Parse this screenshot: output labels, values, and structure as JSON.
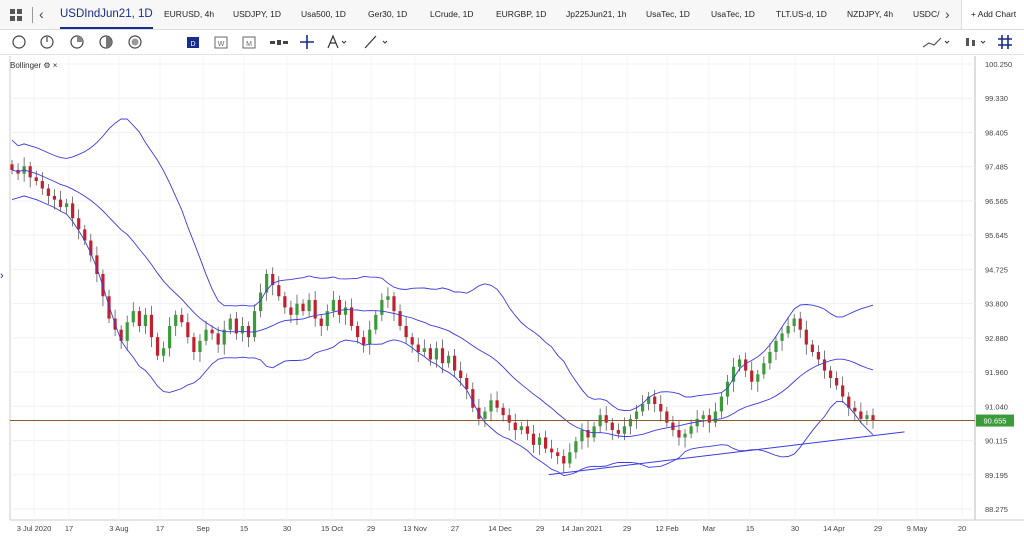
{
  "tabs": [
    {
      "label": "USDIndJun21, 1D",
      "active": true
    },
    {
      "label": "EURUSD, 4h"
    },
    {
      "label": "USDJPY, 1D"
    },
    {
      "label": "Usa500, 1D"
    },
    {
      "label": "Ger30, 1D"
    },
    {
      "label": "LCrude, 1D"
    },
    {
      "label": "EURGBP, 1D"
    },
    {
      "label": "Jp225Jun21, 1h"
    },
    {
      "label": "UsaTec, 1D"
    },
    {
      "label": "UsaTec, 1D"
    },
    {
      "label": "TLT.US-d, 1D"
    },
    {
      "label": "NZDJPY, 4h"
    },
    {
      "label": "USDC/"
    }
  ],
  "add_chart_label": "+ Add Chart",
  "toolbar_icons": [
    "circle-icon",
    "clock-icon",
    "pie-icon",
    "half-circle-icon",
    "target-icon",
    "calendar-d-icon",
    "calendar-w-icon",
    "calendar-m-icon",
    "bars-icon",
    "crosshair-icon",
    "text-a-icon",
    "line-tool-icon",
    "chart-style-icon",
    "candles-icon",
    "grid-icon"
  ],
  "indicator": {
    "label": "Bollinger",
    "settings_icon": "gear-icon",
    "close_icon": "close-icon"
  },
  "chart_data": {
    "type": "candlestick",
    "symbol": "USDIndJun21, 1D",
    "y_ticks": [
      100.25,
      99.33,
      98.405,
      97.485,
      96.565,
      95.645,
      94.725,
      93.8,
      92.88,
      91.96,
      91.04,
      90.115,
      89.195,
      88.275
    ],
    "y_tick_labels": [
      "100.250",
      "99.330",
      "98.405",
      "97.485",
      "96.565",
      "95.645",
      "94.725",
      "93.800",
      "92.880",
      "91.960",
      "91.040",
      "90.115",
      "89.195",
      "88.275"
    ],
    "x_tick_labels": [
      "3 Jul 2020",
      "17",
      "3 Aug",
      "17",
      "Sep",
      "15",
      "30",
      "15 Oct",
      "29",
      "13 Nov",
      "27",
      "14 Dec",
      "29",
      "14 Jan 2021",
      "29",
      "12 Feb",
      "Mar",
      "15",
      "30",
      "14 Apr",
      "29",
      "9 May",
      "20"
    ],
    "current_price": 90.655,
    "current_price_label": "90.655",
    "support_line": {
      "from": {
        "date": "2021-01-06",
        "price": 89.2
      },
      "to": {
        "date": "2021-05-10",
        "price": 90.35
      }
    },
    "closes": [
      97.4,
      97.3,
      97.5,
      97.2,
      97.1,
      96.9,
      96.7,
      96.6,
      96.4,
      96.5,
      96.1,
      95.8,
      95.5,
      95.1,
      94.6,
      94.0,
      93.4,
      93.1,
      92.8,
      93.3,
      93.6,
      93.2,
      93.5,
      92.9,
      92.4,
      92.6,
      93.2,
      93.5,
      93.3,
      92.9,
      92.5,
      92.8,
      93.1,
      93.0,
      92.7,
      93.1,
      93.4,
      93.0,
      93.2,
      92.9,
      93.6,
      94.1,
      94.6,
      94.3,
      94.0,
      93.7,
      93.5,
      93.8,
      93.6,
      93.9,
      93.4,
      93.2,
      93.6,
      93.9,
      93.5,
      93.7,
      93.2,
      92.9,
      92.7,
      93.1,
      93.5,
      93.9,
      94.0,
      93.6,
      93.2,
      92.9,
      92.7,
      92.5,
      92.6,
      92.3,
      92.6,
      92.2,
      92.4,
      92.0,
      91.8,
      91.5,
      91.0,
      90.7,
      90.9,
      91.2,
      91.0,
      90.8,
      90.6,
      90.4,
      90.5,
      90.3,
      90.0,
      90.2,
      89.9,
      89.8,
      89.7,
      89.5,
      89.8,
      90.1,
      90.4,
      90.2,
      90.5,
      90.8,
      90.6,
      90.4,
      90.3,
      90.5,
      90.7,
      90.9,
      91.1,
      91.3,
      91.1,
      90.9,
      90.6,
      90.4,
      90.2,
      90.3,
      90.5,
      90.7,
      90.8,
      90.6,
      90.9,
      91.3,
      91.7,
      92.1,
      92.3,
      92.0,
      91.7,
      91.9,
      92.2,
      92.5,
      92.8,
      93.0,
      93.2,
      93.4,
      93.1,
      92.7,
      92.5,
      92.3,
      92.0,
      91.8,
      91.6,
      91.3,
      91.0,
      90.9,
      90.7,
      90.8,
      90.655
    ]
  }
}
